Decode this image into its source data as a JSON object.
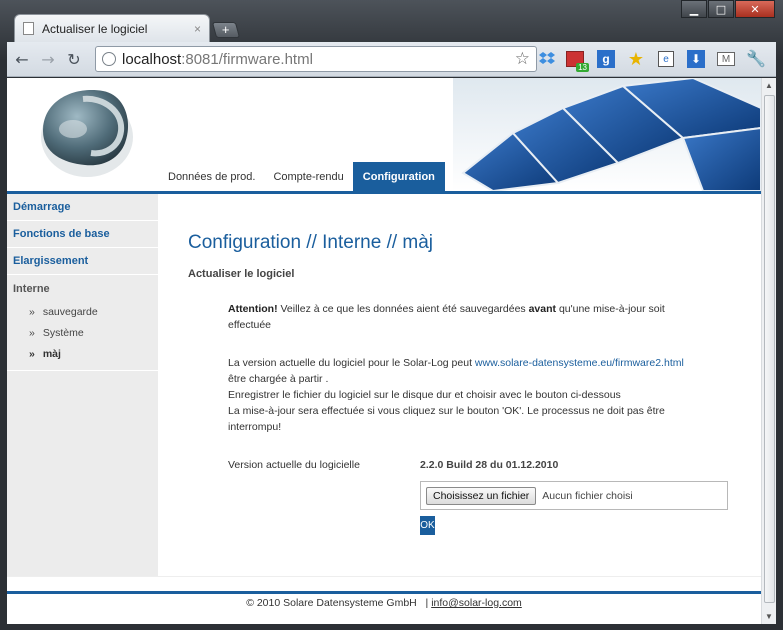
{
  "browser": {
    "tab_title": "Actualiser le logiciel",
    "tab_close": "×",
    "new_tab": "+",
    "url_host": "localhost",
    "url_path": ":8081/firmware.html",
    "back": "←",
    "forward": "→",
    "reload": "↻",
    "bookmark_star": "☆",
    "window_minimize": "▁",
    "window_maximize": "□",
    "window_close": "✕",
    "ext_badge": "13"
  },
  "header": {
    "nav_tabs": [
      "Données de prod.",
      "Compte-rendu",
      "Configuration"
    ]
  },
  "sidebar": {
    "items": [
      "Démarrage",
      "Fonctions de base",
      "Elargissement"
    ],
    "group_label": "Interne",
    "sub_items": [
      "sauvegarde",
      "Système",
      "màj"
    ],
    "bullet": "»"
  },
  "content": {
    "title": "Configuration // Interne // màj",
    "subtitle": "Actualiser le logiciel",
    "attention_label": "Attention!",
    "attention_text_1": " Veillez à ce que les données aient été sauvegardées ",
    "attention_bold": "avant",
    "attention_text_2": " qu'une mise-à-jour soit effectuée",
    "info_line_1": "La version actuelle du logiciel pour le Solar-Log peut ",
    "info_link": "www.solare-datensysteme.eu/firmware2.html",
    "info_line_2": "être chargée à partir .",
    "info_line_3": "Enregistrer le fichier du logiciel sur le disque dur et choisir avec le bouton ci-dessous",
    "info_line_4": "La mise-à-jour sera effectuée si vous cliquez sur le bouton 'OK'. Le processus ne doit pas être interrompu!",
    "version_label": "Version actuelle du logicielle",
    "version_value": "2.2.0 Build 28 du 01.12.2010",
    "file_button": "Choisissez un fichier",
    "file_none": "Aucun fichier choisi",
    "ok_button": "OK"
  },
  "footer": {
    "copyright": "© 2010 Solare Datensysteme GmbH",
    "divider": "|",
    "email": "info@solar-log.com"
  },
  "colors": {
    "accent": "#1a5e9d",
    "sidebar_bg": "#ececec"
  }
}
